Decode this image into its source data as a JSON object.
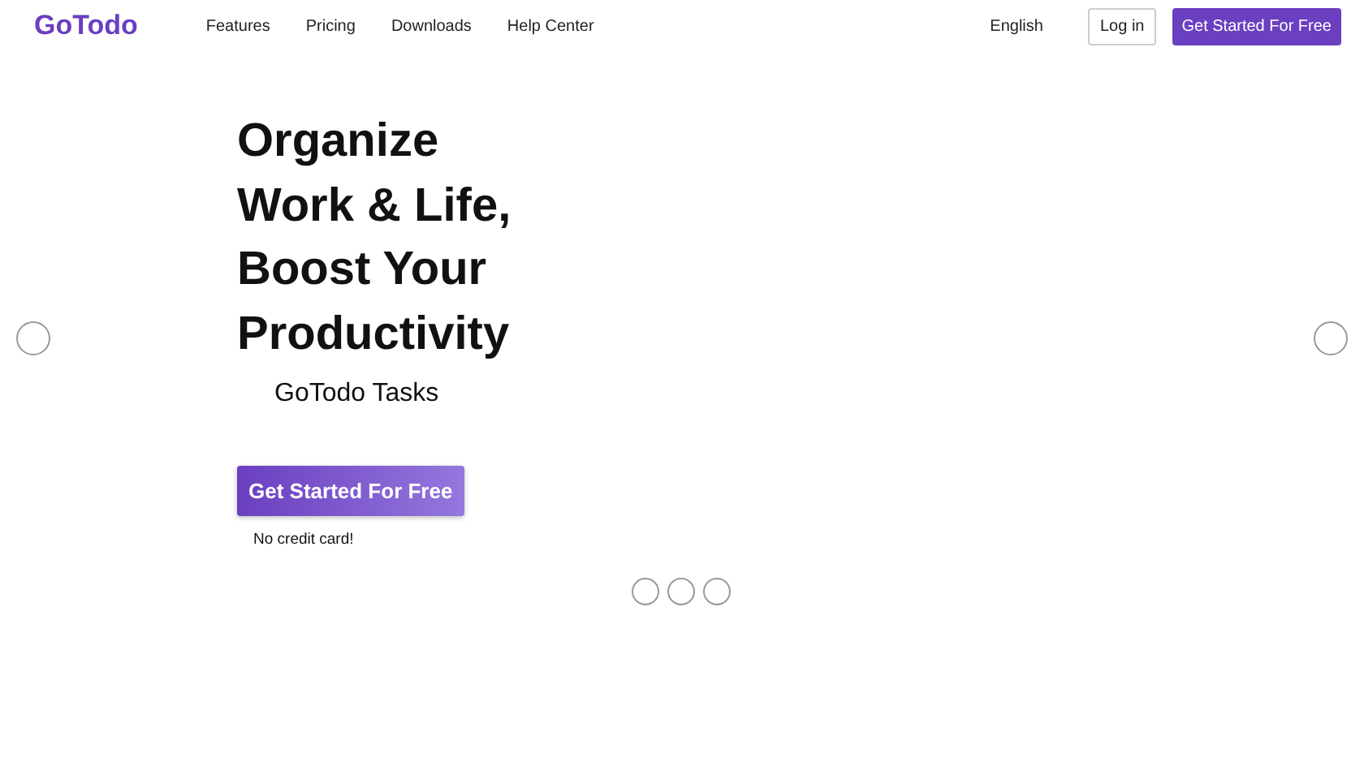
{
  "header": {
    "logo": "GoTodo",
    "nav": [
      "Features",
      "Pricing",
      "Downloads",
      "Help Center"
    ],
    "language": "English",
    "login": "Log in",
    "cta": "Get Started For Free"
  },
  "hero": {
    "title_lines": [
      "Organize",
      "Work & Life,",
      "Boost Your",
      "Productivity"
    ],
    "subtitle": "GoTodo Tasks",
    "cta": "Get Started For Free",
    "note": "No credit card!"
  },
  "carousel": {
    "dots": [
      {
        "selected": false
      },
      {
        "selected": false
      },
      {
        "selected": false
      }
    ]
  }
}
